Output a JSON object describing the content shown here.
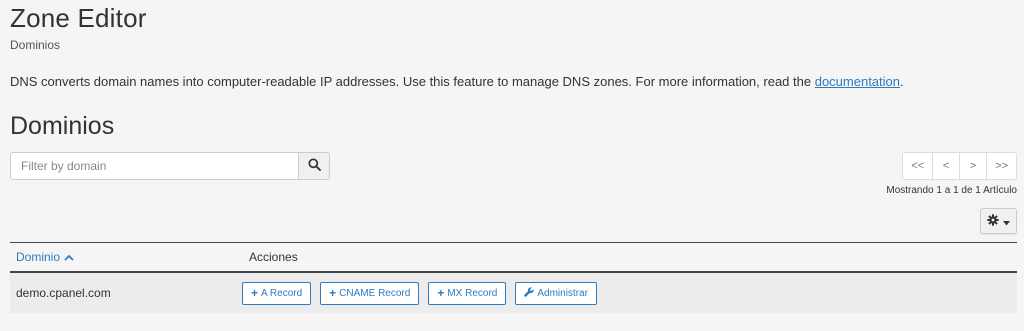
{
  "header": {
    "title": "Zone Editor",
    "subtitle": "Dominios",
    "description_prefix": "DNS converts domain names into computer-readable IP addresses. Use this feature to manage DNS zones. For more information, read the ",
    "description_link": "documentation",
    "description_suffix": "."
  },
  "section": {
    "title": "Dominios"
  },
  "search": {
    "placeholder": "Filter by domain",
    "value": "",
    "icon": "search-icon"
  },
  "pagination": {
    "first": "<<",
    "prev": "<",
    "next": ">",
    "last": ">>",
    "showing": "Mostrando 1 a 1 de 1 Artículo"
  },
  "settings": {
    "icon": "gear-icon"
  },
  "table": {
    "columns": {
      "domain": "Dominio",
      "actions": "Acciones"
    },
    "sort_icon": "chevron-up-icon",
    "rows": [
      {
        "domain": "demo.cpanel.com",
        "actions": [
          "A Record",
          "CNAME Record",
          "MX Record",
          "Administrar"
        ]
      }
    ]
  },
  "colors": {
    "accent": "#2e7bbf",
    "background": "#f5f5f5",
    "row_bg": "#ececec"
  }
}
